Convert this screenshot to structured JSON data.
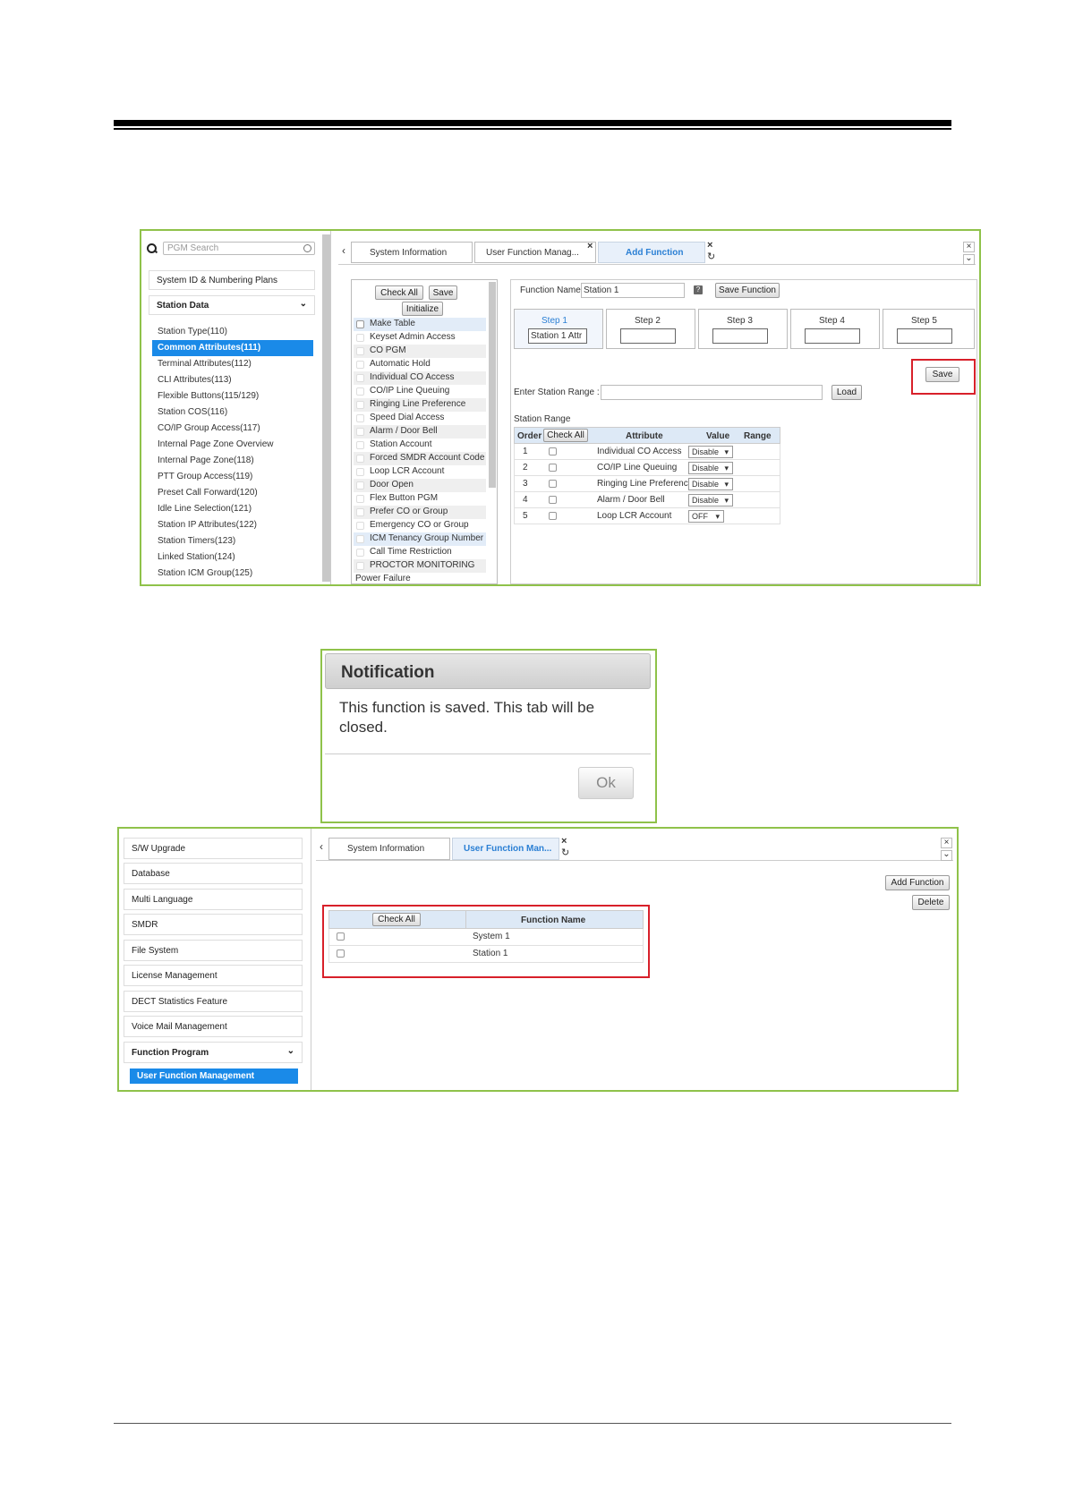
{
  "screenshot1": {
    "search_placeholder": "PGM Search",
    "nav": {
      "system_id": "System ID & Numbering Plans",
      "station_data": "Station Data",
      "items": [
        "Station Type(110)",
        "Common Attributes(111)",
        "Terminal Attributes(112)",
        "CLI Attributes(113)",
        "Flexible Buttons(115/129)",
        "Station COS(116)",
        "CO/IP Group Access(117)",
        "Internal Page Zone Overview",
        "Internal Page Zone(118)",
        "PTT Group Access(119)",
        "Preset Call Forward(120)",
        "Idle Line Selection(121)",
        "Station IP Attributes(122)",
        "Station Timers(123)",
        "Linked Station(124)",
        "Station ICM Group(125)"
      ]
    },
    "tabs": {
      "prev": "‹",
      "system_information": "System Information",
      "user_function_manag": "User Function Manag...",
      "add_function": "Add Function",
      "close": "×",
      "refresh": "↻"
    },
    "attr_list": {
      "check_all": "Check All",
      "save": "Save",
      "initialize": "Initialize",
      "items": [
        "Make Table",
        "Keyset Admin Access",
        "CO PGM",
        "Automatic Hold",
        "Individual CO Access",
        "CO/IP Line Queuing",
        "Ringing Line Preference",
        "Speed Dial Access",
        "Alarm / Door Bell",
        "Station Account",
        "Forced SMDR Account Code",
        "Loop LCR Account",
        "Door Open",
        "Flex Button PGM",
        "Prefer CO or Group",
        "Emergency CO or Group",
        "ICM Tenancy Group Number",
        "Call Time Restriction",
        "PROCTOR MONITORING",
        "Power Failure"
      ]
    },
    "form": {
      "function_name_label": "Function Name:",
      "function_name_value": "Station 1",
      "help": "?",
      "save_function": "Save Function",
      "steps": [
        "Step 1",
        "Step 2",
        "Step 3",
        "Step 4",
        "Step 5"
      ],
      "step1_value": "Station 1 Attr",
      "save": "Save",
      "enter_station_range": "Enter Station Range :",
      "load": "Load",
      "station_range": "Station Range",
      "table": {
        "headers": {
          "order": "Order",
          "check_all": "Check All",
          "attribute": "Attribute",
          "value": "Value",
          "range": "Range"
        },
        "rows": [
          {
            "order": "1",
            "attribute": "Individual CO Access",
            "value": "Disable"
          },
          {
            "order": "2",
            "attribute": "CO/IP Line Queuing",
            "value": "Disable"
          },
          {
            "order": "3",
            "attribute": "Ringing Line Preference",
            "value": "Disable"
          },
          {
            "order": "4",
            "attribute": "Alarm / Door Bell",
            "value": "Disable"
          },
          {
            "order": "5",
            "attribute": "Loop LCR Account",
            "value": "OFF"
          }
        ]
      }
    },
    "window_close": "×",
    "window_collapse": "⌄"
  },
  "notification": {
    "title": "Notification",
    "message": "This function is saved. This tab will be closed.",
    "ok": "Ok"
  },
  "screenshot2": {
    "nav": [
      "S/W Upgrade",
      "Database",
      "Multi Language",
      "SMDR",
      "File System",
      "License Management",
      "DECT Statistics Feature",
      "Voice Mail Management",
      "Function Program",
      "User Function Management"
    ],
    "tabs": {
      "prev": "‹",
      "system_information": "System Information",
      "user_function_man": "User Function Man...",
      "close": "×",
      "refresh": "↻"
    },
    "add_function": "Add Function",
    "delete": "Delete",
    "table": {
      "check_all": "Check All",
      "function_name": "Function Name",
      "rows": [
        "System 1",
        "Station 1"
      ]
    },
    "window_close": "×",
    "window_collapse": "⌄"
  }
}
